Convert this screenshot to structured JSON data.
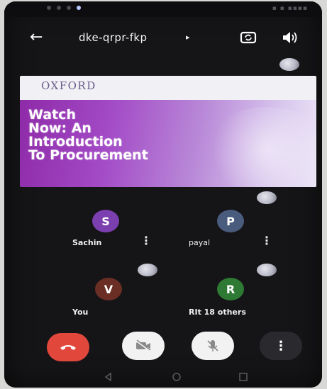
{
  "meeting": {
    "code": "dke-qrpr-fkp",
    "code_caret": "▸"
  },
  "icons": {
    "back": "arrow-back-icon",
    "switch_camera": "switch-camera-icon",
    "speaker": "speaker-icon",
    "end_call": "end-call-icon",
    "camera_off": "camera-off-icon",
    "mic_off": "mic-off-icon",
    "more": "more-vertical-icon"
  },
  "presentation": {
    "logo": "OXFORD",
    "title": "Watch\nNow: An\nIntroduction\nTo Procurement"
  },
  "participants": [
    {
      "name": "Sachin",
      "initial": "S",
      "color": "#7b3fb0"
    },
    {
      "name": "payal",
      "initial": "P",
      "color": "#4a5c7e"
    },
    {
      "name": "You",
      "initial": "V",
      "color": "#6a2e24"
    },
    {
      "name": "RIt 18 others",
      "initial": "R",
      "color": "#2e7a34"
    }
  ],
  "colors": {
    "end_call": "#e2473c",
    "background": "#151517"
  }
}
